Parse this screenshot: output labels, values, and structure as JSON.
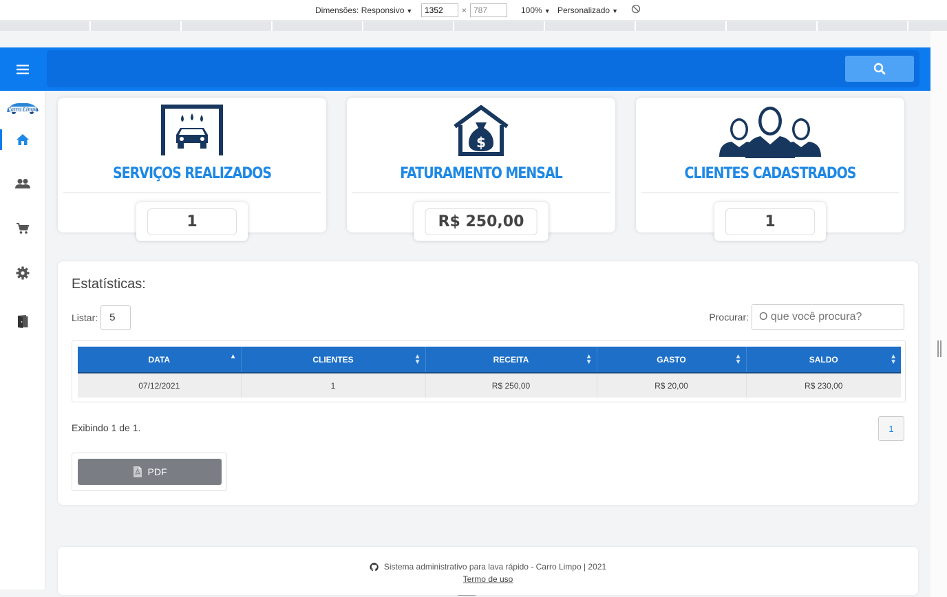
{
  "devtools": {
    "dimensions_label": "Dimensões: Responsivo",
    "width_value": "1352",
    "height_value": "787",
    "zoom": "100%",
    "throttle": "Personalizado",
    "times_symbol": "×"
  },
  "sidebar": {
    "logo_text": "Carro Limpo",
    "items": [
      {
        "icon": "home-icon",
        "active": true
      },
      {
        "icon": "users-icon",
        "active": false
      },
      {
        "icon": "cart-icon",
        "active": false
      },
      {
        "icon": "gear-icon",
        "active": false
      },
      {
        "icon": "exit-door-icon",
        "active": false
      }
    ]
  },
  "cards": [
    {
      "title": "SERVIÇOS REALIZADOS",
      "value": "1",
      "icon": "car-wash-icon"
    },
    {
      "title": "FATURAMENTO MENSAL",
      "value": "R$ 250,00",
      "icon": "money-house-icon"
    },
    {
      "title": "CLIENTES CADASTRADOS",
      "value": "1",
      "icon": "customers-icon"
    }
  ],
  "stats": {
    "title": "Estatísticas:",
    "listar_label": "Listar:",
    "listar_value": "5",
    "procurar_label": "Procurar:",
    "search_placeholder": "O que você procura?",
    "columns": [
      "DATA",
      "CLIENTES",
      "RECEITA",
      "GASTO",
      "SALDO"
    ],
    "rows": [
      [
        "07/12/2021",
        "1",
        "R$ 250,00",
        "R$ 20,00",
        "R$ 230,00"
      ]
    ],
    "showing_text": "Exibindo 1 de 1.",
    "page": "1",
    "pdf_label": "PDF"
  },
  "footer": {
    "text": "Sistema administrativo para lava rápido - Carro Limpo | 2021",
    "terms": "Termo de uso"
  },
  "colors": {
    "primary": "#0d7bf0",
    "table_header": "#1d6fc7",
    "card_title": "#1e88e5",
    "icon_dark": "#17375e",
    "pdf_button": "#7a7e84"
  }
}
